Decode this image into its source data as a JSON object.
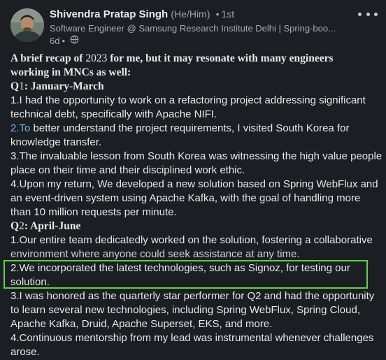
{
  "author": {
    "name": "Shivendra Pratap Singh",
    "pronouns": "(He/Him)",
    "degree_separator": "•",
    "degree": "1st",
    "headline": "Software Engineer @ Samsung Research Institute Delhi | Spring-boo...",
    "time_ago": "6d",
    "time_separator": "•",
    "visibility_icon": "globe-icon"
  },
  "more_icon": "three-dots-horizontal-icon",
  "post": {
    "intro_line1_a": "A brief recap of ",
    "intro_year": "2023",
    "intro_line1_b": " for me, but it may resonate with many engineers",
    "intro_line2": "working in MNCs as well:",
    "q1_heading_a": "Q",
    "q1_heading_num": "1",
    "q1_heading_b": ": January-March",
    "q1_item1_line1": "1.I had the opportunity to work on a refactoring project addressing significant",
    "q1_item1_line2": "technical debt, specifically with Apache NIFI.",
    "q1_item2_link": "2.To",
    "q1_item2_line1_rest": " better understand the project requirements, I visited South Korea for",
    "q1_item2_line2": "knowledge transfer.",
    "q1_item3_line1": "3.The invaluable lesson from South Korea was witnessing the high value people",
    "q1_item3_line2": "place on their time and their disciplined work ethic.",
    "q1_item4_line1": "4.Upon my return, We developed a new solution based on Spring WebFlux and",
    "q1_item4_line2": "an event-driven system using Apache Kafka, with the goal of handling more",
    "q1_item4_line3": "than 10 million requests per minute.",
    "q2_heading_a": "Q",
    "q2_heading_num": "2",
    "q2_heading_b": ": April-June",
    "q2_item1_line1": "1.Our entire team dedicatedly worked on the solution, fostering a collaborative",
    "q2_item1_line2": "environment where anyone could seek assistance at any time.",
    "q2_item2_line1": "2.We incorporated the latest technologies, such as Signoz, for testing our",
    "q2_item2_line2": "solution.",
    "q2_item3_line1": "3.I was honored as the quarterly star performer for Q2 and had the opportunity",
    "q2_item3_line2": "to learn several new technologies, including Spring WebFlux, Spring Cloud,",
    "q2_item3_line3": "Apache Kafka, Druid, Apache Superset, EKS, and more.",
    "q2_item4_line1": "4.Continuous mentorship from my lead was instrumental whenever challenges",
    "q2_item4_line2": "arose."
  },
  "colors": {
    "background": "#1b1f23",
    "text": "#e6e7e8",
    "secondary_text": "#a4abb3",
    "link": "#70b5f9",
    "highlight_border": "#5fd14a"
  }
}
